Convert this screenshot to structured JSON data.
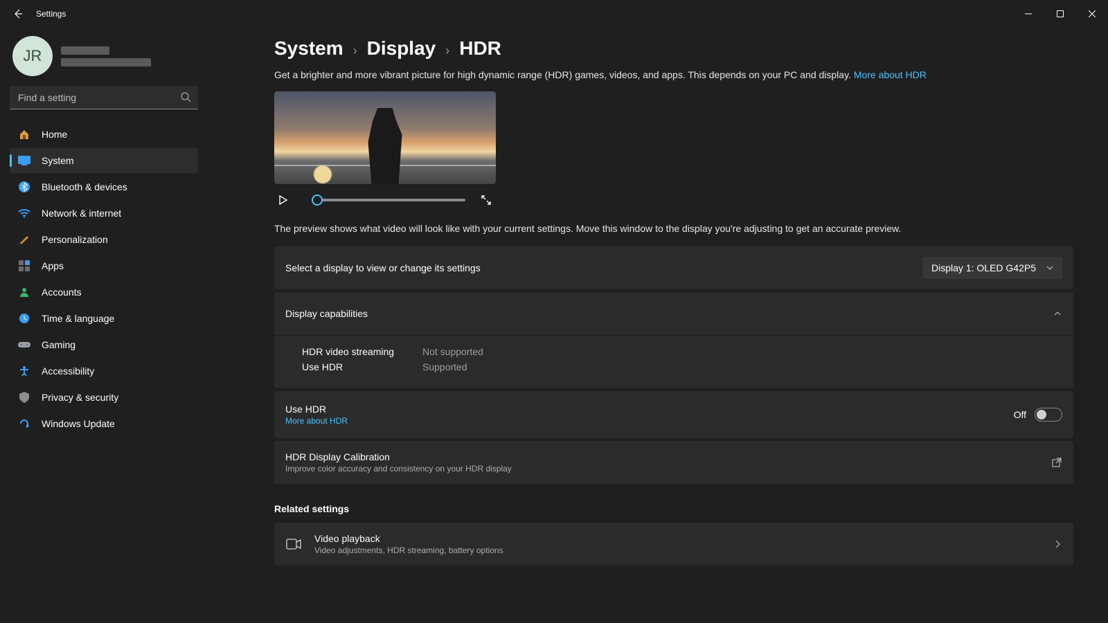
{
  "titlebar": {
    "title": "Settings"
  },
  "user": {
    "initials": "JR"
  },
  "search": {
    "placeholder": "Find a setting"
  },
  "nav": {
    "home": "Home",
    "system": "System",
    "bluetooth": "Bluetooth & devices",
    "network": "Network & internet",
    "personalization": "Personalization",
    "apps": "Apps",
    "accounts": "Accounts",
    "time": "Time & language",
    "gaming": "Gaming",
    "accessibility": "Accessibility",
    "privacy": "Privacy & security",
    "update": "Windows Update"
  },
  "breadcrumb": {
    "a": "System",
    "b": "Display",
    "c": "HDR"
  },
  "intro": {
    "text": "Get a brighter and more vibrant picture for high dynamic range (HDR) games, videos, and apps. This depends on your PC and display. ",
    "link": "More about HDR"
  },
  "caption": "The preview shows what video will look like with your current settings. Move this window to the display you're adjusting to get an accurate preview.",
  "selectDisplay": {
    "label": "Select a display to view or change its settings",
    "value": "Display 1: OLED G42P5"
  },
  "capabilities": {
    "heading": "Display capabilities",
    "rows": [
      {
        "key": "HDR video streaming",
        "val": "Not supported"
      },
      {
        "key": "Use HDR",
        "val": "Supported"
      }
    ]
  },
  "useHdr": {
    "title": "Use HDR",
    "link": "More about HDR",
    "state": "Off"
  },
  "calibration": {
    "title": "HDR Display Calibration",
    "sub": "Improve color accuracy and consistency on your HDR display"
  },
  "related": {
    "heading": "Related settings",
    "video": {
      "title": "Video playback",
      "sub": "Video adjustments, HDR streaming, battery options"
    }
  }
}
